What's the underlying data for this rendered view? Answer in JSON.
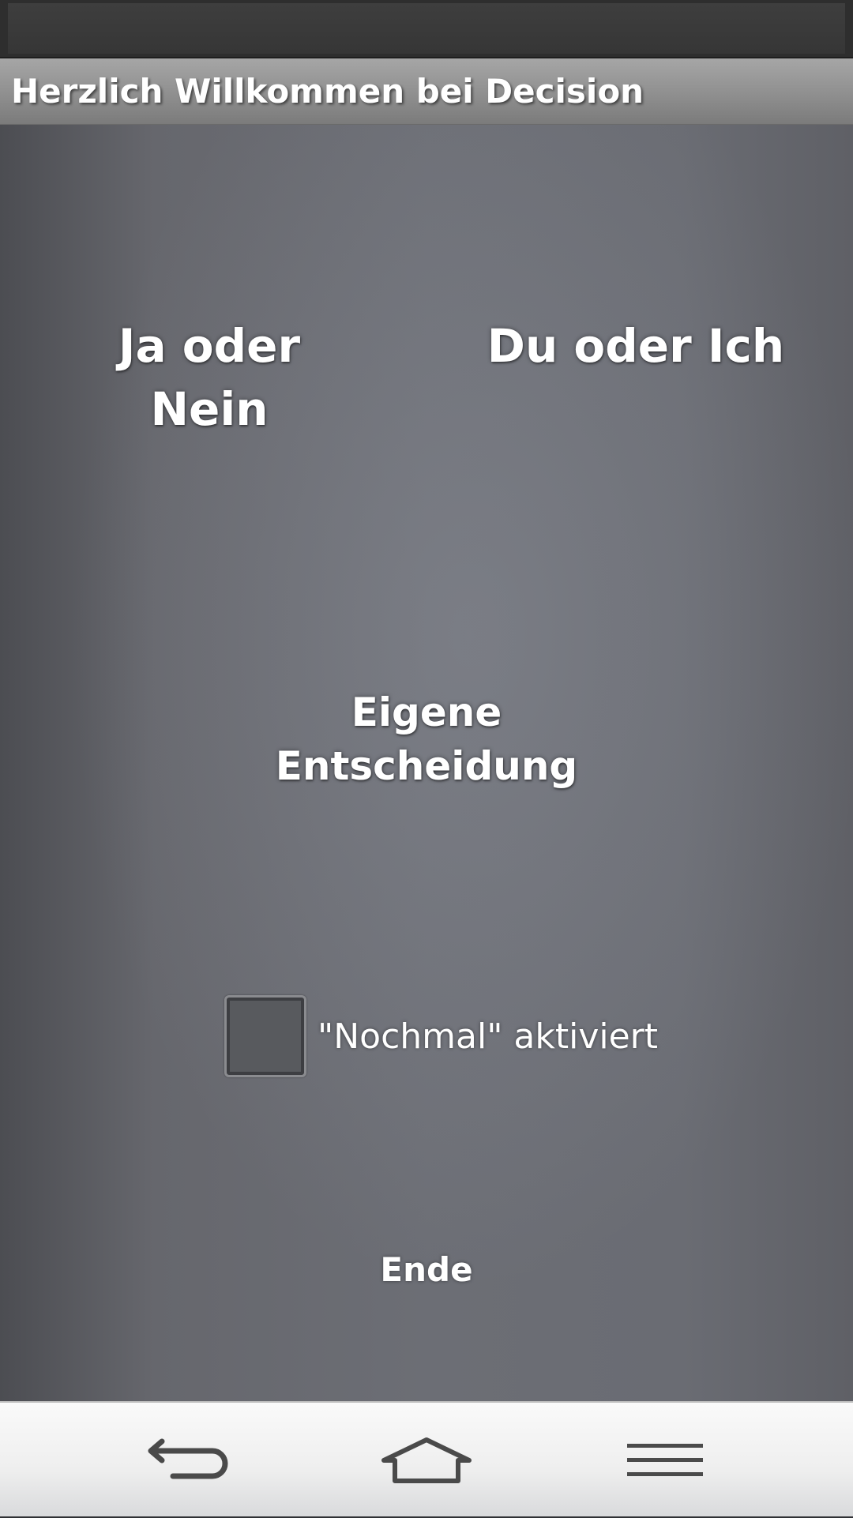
{
  "app": {
    "title": "Herzlich Willkommen bei Decision"
  },
  "main": {
    "option_yes_no": "Ja oder Nein",
    "option_you_me": "Du oder Ich",
    "option_own_decision": "Eigene Entscheidung",
    "repeat_checkbox": {
      "label": "\"Nochmal\" aktiviert",
      "checked": false
    },
    "end_button": "Ende"
  },
  "navigation": {
    "icons": [
      "back-icon",
      "home-icon",
      "menu-icon"
    ]
  }
}
